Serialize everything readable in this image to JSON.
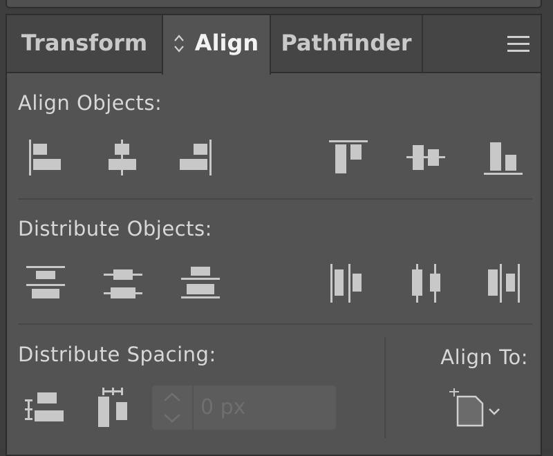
{
  "tabs": [
    {
      "label": "Transform",
      "active": false
    },
    {
      "label": "Align",
      "active": true
    },
    {
      "label": "Pathfinder",
      "active": false
    }
  ],
  "sections": {
    "align_objects": "Align Objects:",
    "distribute_objects": "Distribute Objects:",
    "distribute_spacing": "Distribute Spacing:",
    "align_to": "Align To:"
  },
  "spacing_field": {
    "value": "0 px",
    "disabled": true
  },
  "icons": {
    "align_objects": [
      "align-left-icon",
      "align-horizontal-center-icon",
      "align-right-icon",
      "align-top-icon",
      "align-vertical-center-icon",
      "align-bottom-icon"
    ],
    "distribute_objects": [
      "distribute-top-icon",
      "distribute-vertical-center-icon",
      "distribute-bottom-icon",
      "distribute-left-icon",
      "distribute-horizontal-center-icon",
      "distribute-right-icon"
    ],
    "distribute_spacing": [
      "distribute-vertical-spacing-icon",
      "distribute-horizontal-spacing-icon"
    ],
    "align_to": "align-to-artboard-icon"
  },
  "colors": {
    "panel_bg": "#535353",
    "tabbar_bg": "#454545",
    "icon": "#c8c8c8",
    "text": "#d8d8d8"
  }
}
